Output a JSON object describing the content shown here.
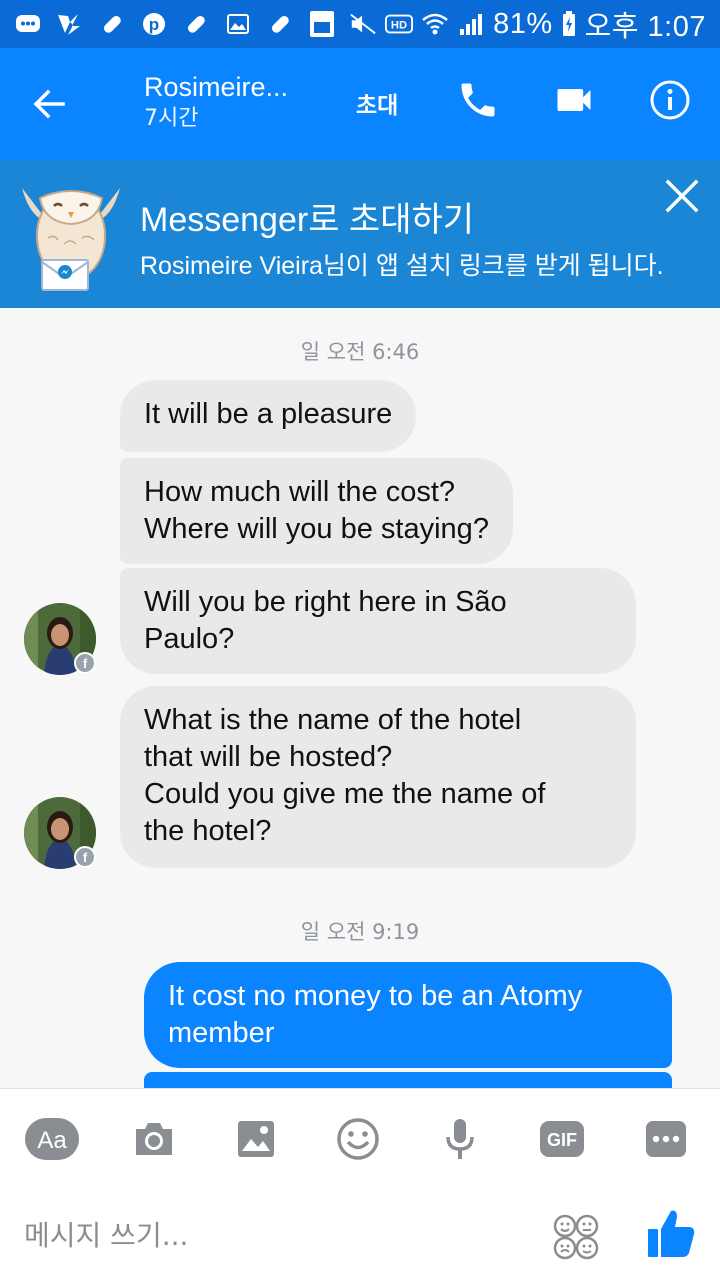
{
  "status_bar": {
    "battery": "81%",
    "time": "오후 1:07",
    "colors": {
      "background": "#0a6bd6"
    },
    "icons": [
      "messenger-notification-icon",
      "app-notification-icon",
      "pill-icon",
      "pinterest-icon",
      "pill-icon",
      "gallery-icon",
      "pill-icon",
      "ebook-icon",
      "mute-icon",
      "hd-icon",
      "wifi-icon",
      "signal-icon",
      "battery-icon"
    ]
  },
  "header": {
    "title": "Rosimeire...",
    "subtitle": "7시간",
    "invite_label": "초대",
    "colors": {
      "background": "#0a84ff"
    }
  },
  "banner": {
    "title": "Messenger로 초대하기",
    "text": "Rosimeire Vieira님이 앱 설치 링크를 받게 됩니다.",
    "colors": {
      "background": "#1b86d6"
    }
  },
  "messages": {
    "timestamp_1": "일 오전 6:46",
    "incoming": [
      "It will be a pleasure",
      "How much will the cost?\nWhere will you be staying?",
      "Will you be right here in São\nPaulo?",
      "What is the name of the hotel\nthat will be hosted?\nCould you give me the name of\nthe hotel?"
    ],
    "timestamp_2": "일 오전 9:19",
    "outgoing": [
      "It cost no money to be an Atomy\nmember"
    ],
    "badge": "f"
  },
  "composer": {
    "placeholder": "메시지 쓰기...",
    "tools": [
      "text-style",
      "camera",
      "gallery",
      "emoji",
      "microphone",
      "gif",
      "more"
    ],
    "text_tool_label": "Aa",
    "gif_label": "GIF",
    "colors": {
      "icon": "#8a8d91",
      "like": "#0a84ff"
    }
  }
}
